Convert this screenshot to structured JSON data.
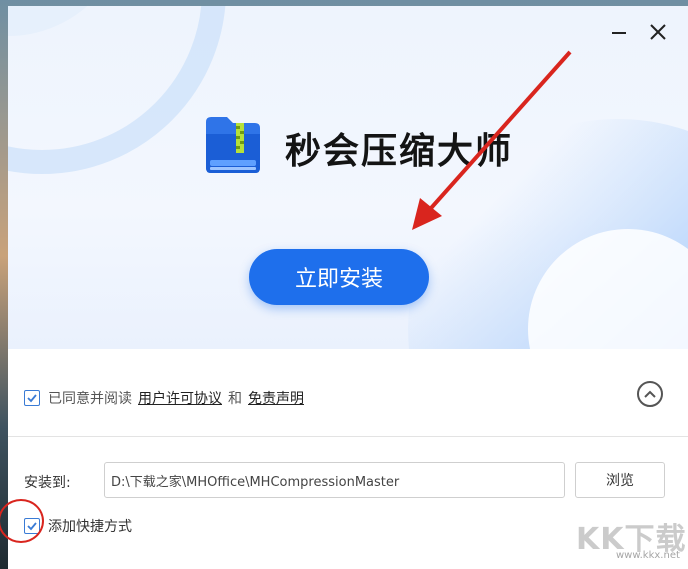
{
  "window": {
    "app_title": "秒会压缩大师",
    "install_button": "立即安装",
    "minimize_icon": "minimize-icon",
    "close_icon": "close-icon"
  },
  "agreement": {
    "checked": true,
    "prefix": "已同意并阅读",
    "license_link": "用户许可协议",
    "and": "和",
    "disclaimer_link": "免责声明"
  },
  "install_path": {
    "label": "安装到:",
    "value": "D:\\下载之家\\MHOffice\\MHCompressionMaster",
    "browse_button": "浏览"
  },
  "shortcut": {
    "checked": true,
    "label": "添加快捷方式"
  },
  "watermark": {
    "text": "KK下载",
    "url": "www.kkx.net"
  },
  "colors": {
    "accent": "#1e6fec",
    "annotation": "#d9251e"
  }
}
